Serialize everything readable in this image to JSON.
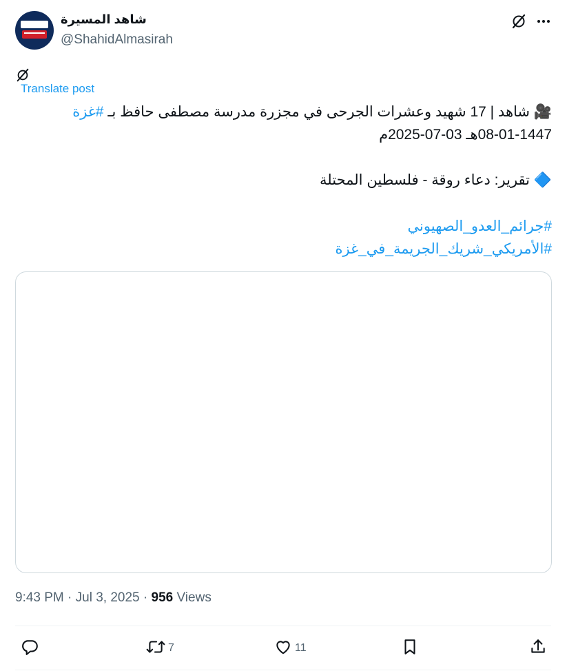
{
  "author": {
    "name": "شاهد المسيرة",
    "handle": "@ShahidAlmasirah",
    "avatar_icon": "shahid-almasirah-logo"
  },
  "header": {
    "grok_icon": "grok-icon",
    "more_icon": "more-icon"
  },
  "translate_label": "Translate post",
  "post": {
    "line1_prefix": "🎥 شاهد | 17 شهيد وعشرات الجرحى في مجزرة مدرسة مصطفى حافظ بـ ",
    "line1_hashtag": "#غزة",
    "line2": "08-01-1447هـ 03-07-2025م",
    "line3": "🔷 تقرير: دعاء روقة - فلسطين المحتلة",
    "hashtag1": "#جرائم_العدو_الصهيوني",
    "hashtag2": "#الأمريكي_شريك_الجريمة_في_غزة"
  },
  "meta": {
    "time": "9:43 PM · Jul 3, 2025 · ",
    "views_count": "956",
    "views_label": " Views"
  },
  "actions": {
    "reply_count": "",
    "retweet_count": "7",
    "like_count": "11"
  },
  "colors": {
    "accent": "#1d9bf0",
    "secondary_text": "#536471",
    "border": "#cfd9de"
  }
}
